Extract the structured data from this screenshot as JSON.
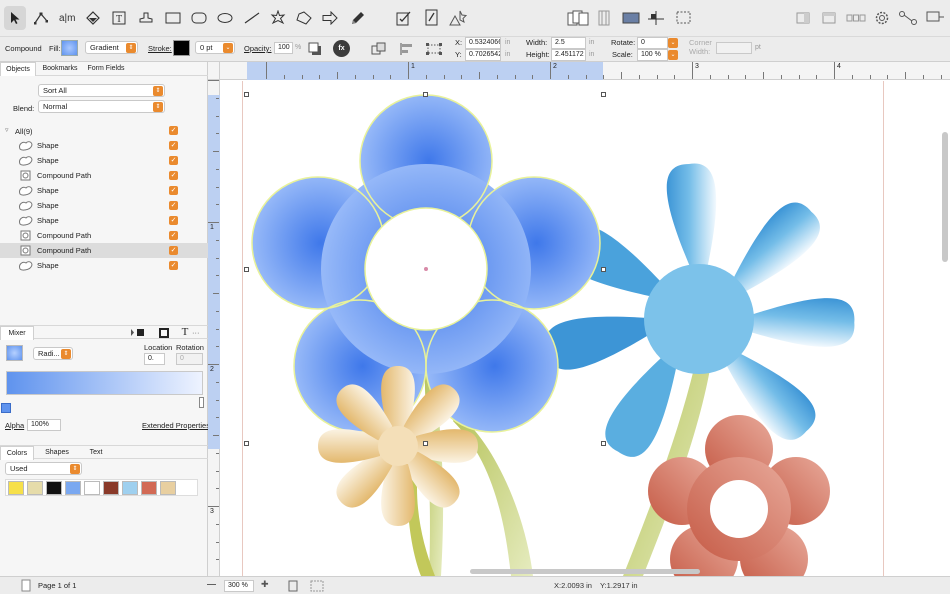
{
  "propbar": {
    "selection_kind": "Compound",
    "fill_label": "Fill:",
    "fill_type": "Gradient",
    "stroke_label": "Stroke:",
    "stroke_width": "0 pt",
    "opacity_label": "Opacity:",
    "opacity_value": "100",
    "opacity_unit": "%",
    "fx_label": "fx",
    "x_label": "X:",
    "x_value": "0.5324066",
    "y_label": "Y:",
    "y_value": "0.7026542",
    "width_label": "Width:",
    "width_value": "2.5",
    "height_label": "Height:",
    "height_value": "2.451172",
    "unit_in": "in",
    "rotate_label": "Rotate:",
    "rotate_value": "0",
    "scale_label": "Scale:",
    "scale_value": "100 %",
    "corner_label_1": "Corner",
    "corner_label_2": "Width:",
    "corner_unit": "pt"
  },
  "left_tabs": [
    "Objects",
    "Bookmarks",
    "Form Fields"
  ],
  "sort_select": "Sort All",
  "blend_label": "Blend:",
  "blend_select": "Normal",
  "tree": {
    "root_label": "All(9)",
    "items": [
      {
        "label": "Shape",
        "icon": "shape-icon",
        "selected": false
      },
      {
        "label": "Shape",
        "icon": "shape-icon",
        "selected": false
      },
      {
        "label": "Compound Path",
        "icon": "compound-path-icon",
        "selected": false
      },
      {
        "label": "Shape",
        "icon": "shape-icon",
        "selected": false
      },
      {
        "label": "Shape",
        "icon": "shape-icon",
        "selected": false
      },
      {
        "label": "Shape",
        "icon": "shape-icon",
        "selected": false
      },
      {
        "label": "Compound Path",
        "icon": "compound-path-icon",
        "selected": false
      },
      {
        "label": "Compound Path",
        "icon": "compound-path-icon",
        "selected": true
      },
      {
        "label": "Shape",
        "icon": "shape-icon",
        "selected": false
      }
    ]
  },
  "mixer": {
    "tab_label": "Mixer",
    "gradient_type": "Radi...",
    "location_label": "Location",
    "location_value": "0.",
    "rotation_label": "Rotation",
    "rotation_value": "0",
    "alpha_label": "Alpha",
    "alpha_value": "100%",
    "extended_link": "Extended Properties",
    "text_tool_glyph": "T",
    "more_glyph": "···"
  },
  "bottom_tabs": [
    "Colors",
    "Shapes",
    "Text"
  ],
  "swatch_filter": "Used",
  "swatches": [
    "#f6e04a",
    "#e6dcaa",
    "#111111",
    "#7aa8f0",
    "#ffffff",
    "#8a3a2a",
    "#9fd0ef",
    "#d26a55",
    "#e8cfa0"
  ],
  "ruler": {
    "h_numbers": [
      "1",
      "2",
      "3",
      "4",
      "5"
    ],
    "v_numbers": [
      "1",
      "2",
      "3"
    ]
  },
  "status": {
    "page_label": "Page 1 of 1",
    "zoom_value": "300 %",
    "zoom_minus": "—",
    "zoom_plus": "✚",
    "x_coord": "X:2.0093 in",
    "y_coord": "Y:1.2917 in"
  },
  "colors": {
    "accent": "#ea8a2e",
    "selection_band": "#bcd0f2",
    "selection_outline": "#e8f29a"
  }
}
